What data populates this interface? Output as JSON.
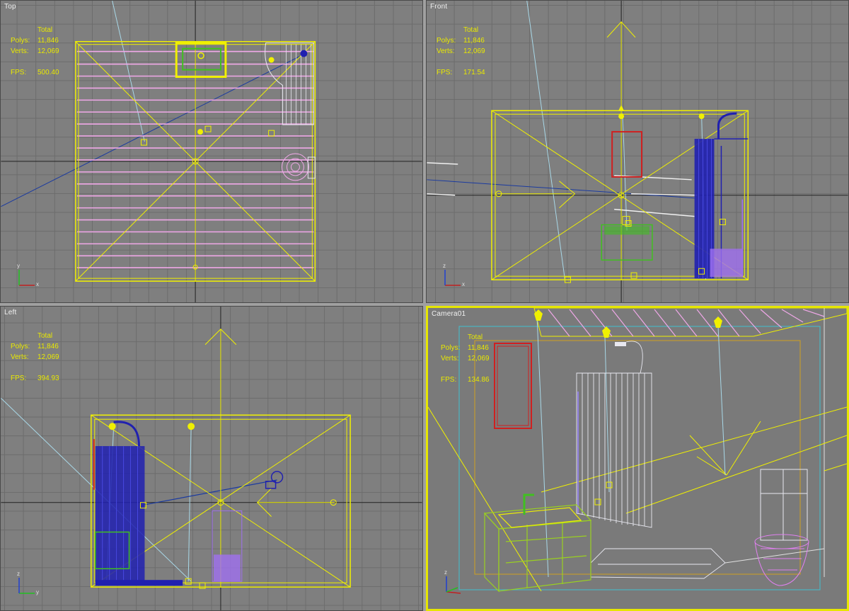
{
  "viewports": {
    "top": {
      "label": "Top",
      "total": "Total",
      "polys_label": "Polys:",
      "polys": "11,846",
      "verts_label": "Verts:",
      "verts": "12,069",
      "fps_label": "FPS:",
      "fps": "500.40"
    },
    "front": {
      "label": "Front",
      "total": "Total",
      "polys_label": "Polys:",
      "polys": "11,846",
      "verts_label": "Verts:",
      "verts": "12,069",
      "fps_label": "FPS:",
      "fps": "171.54"
    },
    "left": {
      "label": "Left",
      "total": "Total",
      "polys_label": "Polys:",
      "polys": "11,846",
      "verts_label": "Verts:",
      "verts": "12,069",
      "fps_label": "FPS:",
      "fps": "394.93"
    },
    "camera": {
      "label": "Camera01",
      "total": "Total",
      "polys_label": "Polys:",
      "polys": "11,846",
      "verts_label": "Verts:",
      "verts": "12,069",
      "fps_label": "FPS:",
      "fps": "134.86"
    }
  },
  "axis_labels": {
    "x": "x",
    "y": "y",
    "z": "z"
  },
  "colors": {
    "viewport_bg": "#7f7f7f",
    "grid": "#6c6c6c",
    "stats_text": "#e9e900",
    "active_border": "#e6e600",
    "room": "#f0f000",
    "ceiling": "#f0a0e0",
    "shower": "#2020b0",
    "sink": "#40c020",
    "mirror": "#d02020",
    "toilet": "#a070f0",
    "light_line": "#80d0e0",
    "camera_line": "#1a3aa0"
  }
}
